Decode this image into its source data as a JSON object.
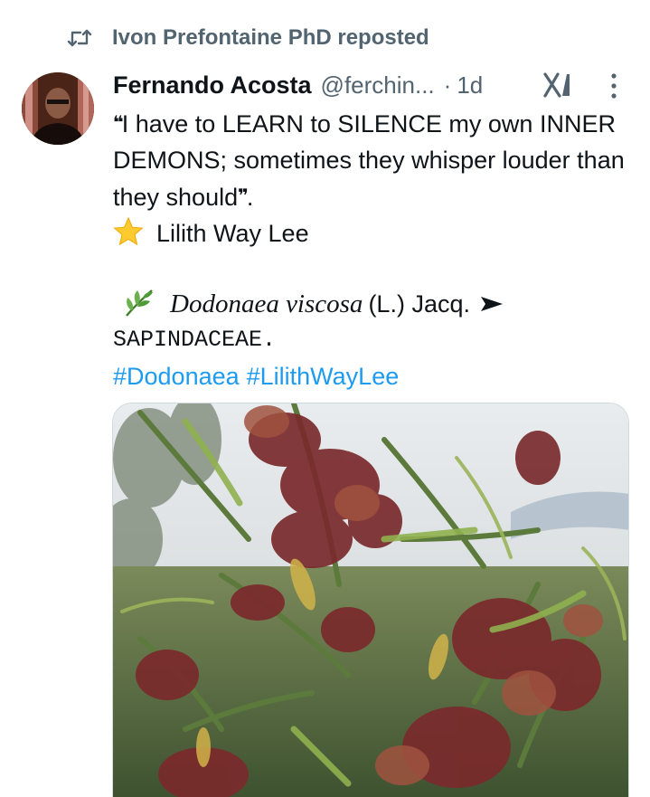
{
  "repost": {
    "icon": "repost-icon",
    "text": "Ivon Prefontaine PhD reposted"
  },
  "author": {
    "avatar_icon": "user-avatar",
    "name": "Fernando Acosta",
    "handle": "@ferchin...",
    "separator": "·",
    "time": "1d"
  },
  "actions": {
    "grok_icon": "grok-icon",
    "more_icon": "more-vertical-icon"
  },
  "post": {
    "quote_open": "❝",
    "line_main": "I have to LEARN to SILENCE my own INNER DEMONS; sometimes they whisper louder than they should",
    "quote_close": "❞",
    "line_end": ".",
    "star_icon": "star-emoji",
    "attribution": "Lilith Way Lee",
    "leaf_icon": "herb-emoji",
    "species": "Dodonaea viscosa",
    "species_author": "(L.) Jacq.",
    "arrow": "➤",
    "family": "SAPINDACEAE.",
    "hashtags": [
      "#Dodonaea",
      "#LilithWayLee"
    ]
  },
  "media": {
    "alt": "Photo of Dodonaea viscosa shrub with reddish winged seed capsules"
  },
  "colors": {
    "text": "#0f1419",
    "secondary": "#536471",
    "link": "#1d9bf0"
  }
}
